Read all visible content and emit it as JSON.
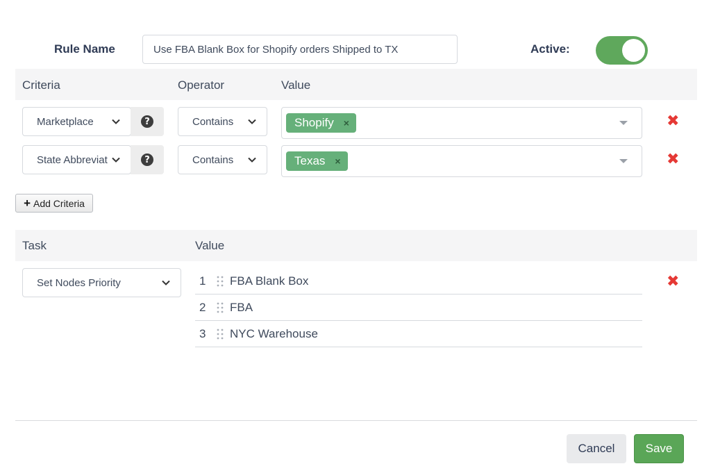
{
  "rule": {
    "name_label": "Rule Name",
    "name_value": "Use FBA Blank Box for Shopify orders Shipped to TX",
    "active_label": "Active:",
    "active": true
  },
  "criteria_header": {
    "criteria": "Criteria",
    "operator": "Operator",
    "value": "Value"
  },
  "criteria": [
    {
      "field": "Marketplace",
      "operator": "Contains",
      "value_tag": "Shopify"
    },
    {
      "field": "State Abbreviat",
      "operator": "Contains",
      "value_tag": "Texas"
    }
  ],
  "add_criteria_label": "Add Criteria",
  "task_header": {
    "task": "Task",
    "value": "Value"
  },
  "task": {
    "selected": "Set Nodes Priority",
    "priorities": [
      {
        "num": "1",
        "name": "FBA Blank Box"
      },
      {
        "num": "2",
        "name": "FBA"
      },
      {
        "num": "3",
        "name": "NYC Warehouse"
      }
    ]
  },
  "footer": {
    "cancel_label": "Cancel",
    "save_label": "Save"
  },
  "colors": {
    "accent_green": "#5fa85c",
    "tag_green": "#66b07a",
    "delete_red": "#e53935"
  },
  "icons": {
    "help": "question-circle-icon",
    "delete": "close-icon",
    "add": "plus-icon",
    "drag": "drag-handle-icon",
    "dropdown": "chevron-down-icon"
  }
}
